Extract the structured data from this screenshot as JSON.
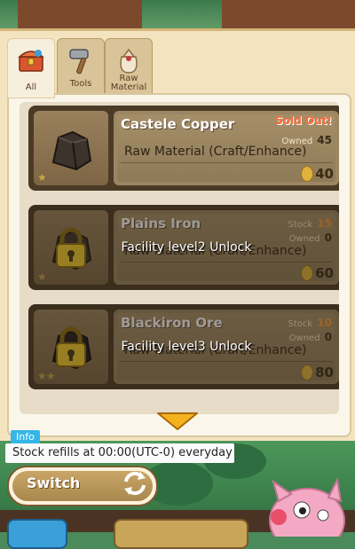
{
  "tabs": [
    {
      "label": "All",
      "icon": "treasure-chest-icon",
      "active": true
    },
    {
      "label": "Tools",
      "icon": "hammer-icon",
      "active": false
    },
    {
      "label": "Raw Material",
      "icon": "material-bag-icon",
      "active": false
    }
  ],
  "items": [
    {
      "name": "Castele Copper",
      "type": "Raw Material (Craft/Enhance)",
      "status": "Sold Out!",
      "owned_label": "Owned",
      "owned": "45",
      "price": "40",
      "stars": 1,
      "locked": false
    },
    {
      "name": "Plains Iron",
      "type": "Raw Material (Craft/Enhance)",
      "stock_label": "Stock",
      "stock": "15",
      "owned_label": "Owned",
      "owned": "0",
      "price": "60",
      "stars": 1,
      "locked": true,
      "lock_text": "Facility level2 Unlock"
    },
    {
      "name": "Blackiron Ore",
      "type": "Raw Material (Craft/Enhance)",
      "stock_label": "Stock",
      "stock": "10",
      "owned_label": "Owned",
      "owned": "0",
      "price": "80",
      "stars": 2,
      "locked": true,
      "lock_text": "Facility level3 Unlock"
    }
  ],
  "info": {
    "badge": "Info",
    "text": "Stock refills at 00:00(UTC-0) everyday"
  },
  "switch_button": {
    "label": "Switch",
    "icon": "refresh-arrows-icon"
  },
  "colors": {
    "sold_out": "#ff6a3a",
    "stock": "#ff9b33",
    "info_badge": "#35b6e6"
  }
}
